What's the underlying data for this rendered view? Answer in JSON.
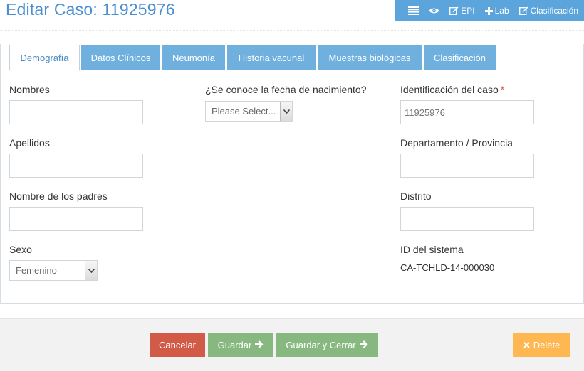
{
  "header": {
    "title": "Editar Caso: 11925976"
  },
  "toolbar": {
    "items": [
      {
        "icon": "list-icon",
        "label": ""
      },
      {
        "icon": "eye-icon",
        "label": ""
      },
      {
        "icon": "edit-icon",
        "label": "EPI"
      },
      {
        "icon": "plus-icon",
        "label": "Lab"
      },
      {
        "icon": "edit-icon",
        "label": "Clasificación"
      }
    ]
  },
  "tabs": [
    {
      "label": "Demografía",
      "active": true
    },
    {
      "label": "Datos Clínicos",
      "active": false
    },
    {
      "label": "Neumonía",
      "active": false
    },
    {
      "label": "Historia vacunal",
      "active": false
    },
    {
      "label": "Muestras biológicas",
      "active": false
    },
    {
      "label": "Clasificación",
      "active": false
    }
  ],
  "form": {
    "nombres_label": "Nombres",
    "nombres_value": "",
    "apellidos_label": "Apellidos",
    "apellidos_value": "",
    "padres_label": "Nombre de los padres",
    "padres_value": "",
    "sexo_label": "Sexo",
    "sexo_value": "Femenino",
    "fecha_label": "¿Se conoce la fecha de nacimiento?",
    "fecha_value": "Please Select...",
    "identificacion_label": "Identificación del caso",
    "identificacion_required": "*",
    "identificacion_value": "11925976",
    "departamento_label": "Departamento / Provincia",
    "departamento_value": "",
    "distrito_label": "Distrito",
    "distrito_value": "",
    "sistema_label": "ID del sistema",
    "sistema_value": "CA-TCHLD-14-000030"
  },
  "footer": {
    "cancel_label": "Cancelar",
    "save_label": "Guardar",
    "save_close_label": "Guardar y Cerrar",
    "delete_label": "Delete"
  },
  "colors": {
    "accent": "#4a8ed0",
    "toolbar": "#5ba5dc",
    "tab": "#6fb0de",
    "cancel": "#d15b47",
    "save": "#87b87f",
    "delete": "#ffb752"
  }
}
